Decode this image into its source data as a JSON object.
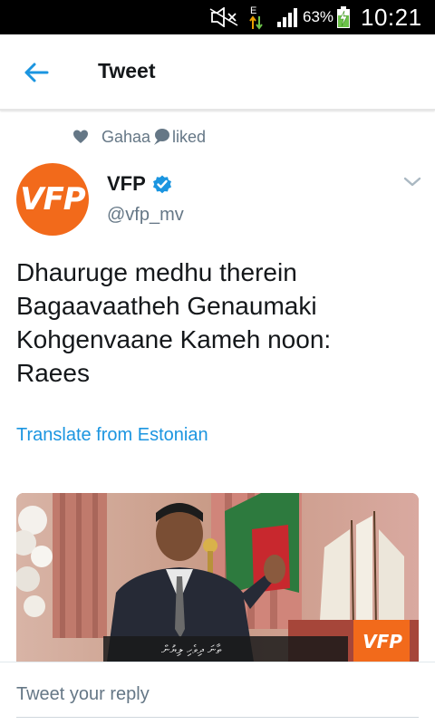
{
  "status_bar": {
    "battery_percent": "63%",
    "time": "10:21",
    "icons": [
      "mute-icon",
      "data-arrows-icon",
      "signal-icon",
      "battery-charging-icon"
    ]
  },
  "app_bar": {
    "title": "Tweet",
    "back_icon": "back-arrow-icon"
  },
  "social_context": {
    "user": "Gahaa",
    "action": "liked"
  },
  "tweet": {
    "author_name": "VFP",
    "author_handle": "@vfp_mv",
    "avatar_text": "VFP",
    "verified": true,
    "text_lines": [
      "Dhauruge medhu therein",
      "Bagaavaatheh Genaumaki",
      "Kohgenvaane Kameh noon:",
      "Raees"
    ],
    "translate_label": "Translate from Estonian",
    "media": {
      "watermark": "VFP"
    }
  },
  "reply": {
    "placeholder": "Tweet your reply"
  },
  "colors": {
    "accent": "#1b95e0",
    "avatar_orange": "#f26a1b",
    "muted_text": "#657786",
    "status_bar": "#000000"
  }
}
